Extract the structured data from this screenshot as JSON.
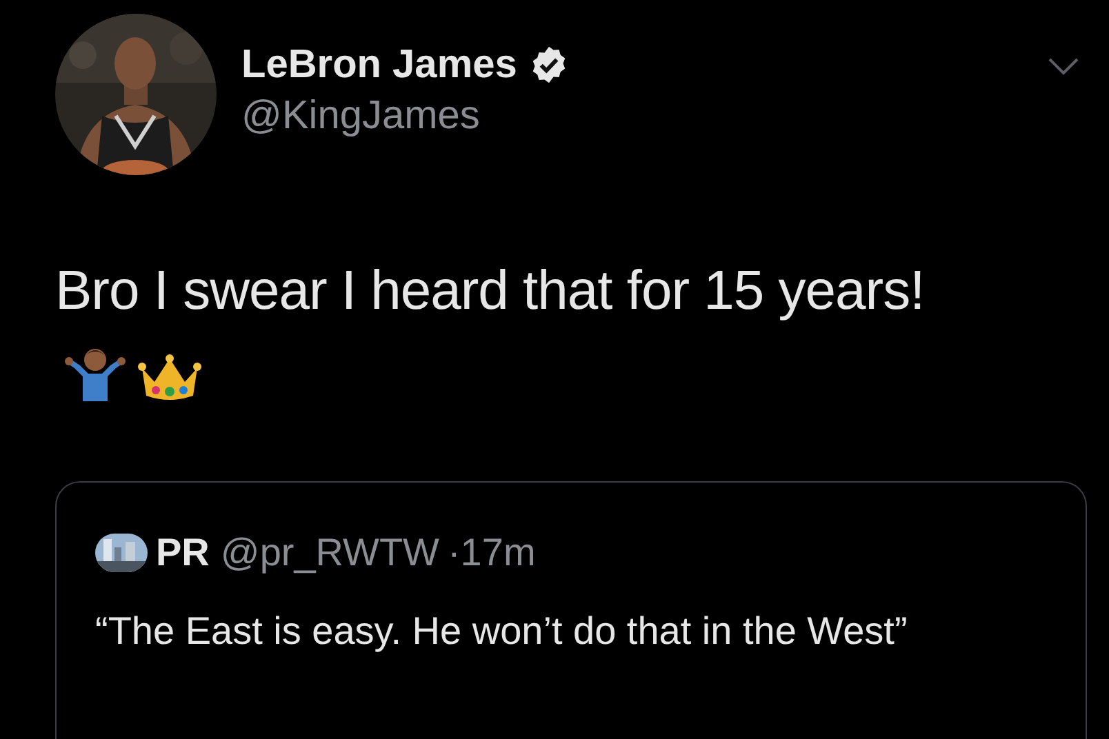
{
  "tweet": {
    "author": {
      "name": "LeBron James",
      "verified": true,
      "handle": "@KingJames"
    },
    "text": "Bro I swear I heard that for 15 years!",
    "quote": {
      "name": "PR",
      "handle": "@pr_RWTW",
      "time": "·17m",
      "text": "“The East is easy. He won’t do that in the West”"
    }
  }
}
